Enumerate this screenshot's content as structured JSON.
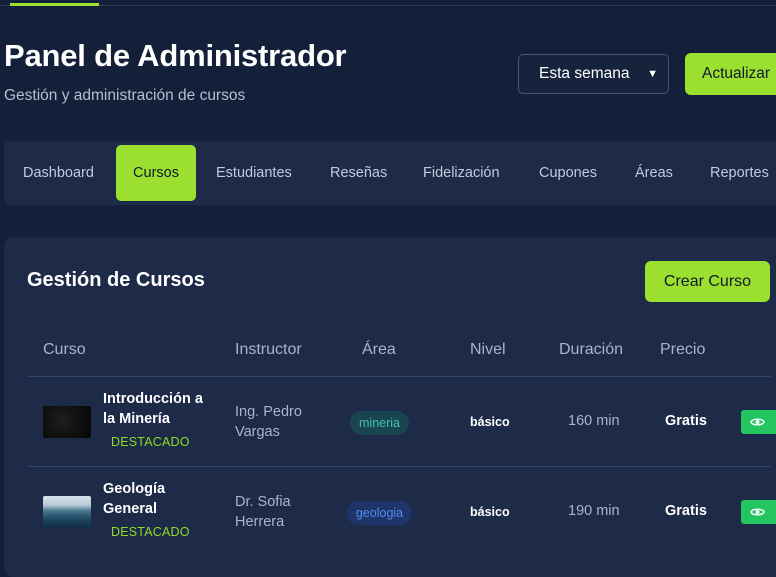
{
  "header": {
    "title": "Panel de Administrador",
    "subtitle": "Gestión y administración de cursos",
    "period_select": {
      "value": "Esta semana"
    },
    "update_label": "Actualizar"
  },
  "tabs": [
    {
      "label": "Dashboard",
      "active": false
    },
    {
      "label": "Cursos",
      "active": true
    },
    {
      "label": "Estudiantes",
      "active": false
    },
    {
      "label": "Reseñas",
      "active": false
    },
    {
      "label": "Fidelización",
      "active": false
    },
    {
      "label": "Cupones",
      "active": false
    },
    {
      "label": "Áreas",
      "active": false
    },
    {
      "label": "Reportes",
      "active": false
    }
  ],
  "courses_panel": {
    "title": "Gestión de Cursos",
    "create_label": "Crear Curso",
    "columns": [
      "Curso",
      "Instructor",
      "Área",
      "Nivel",
      "Duración",
      "Precio"
    ],
    "rows": [
      {
        "name": "Introducción a la Minería",
        "featured": "DESTACADO",
        "instructor": "Ing. Pedro Vargas",
        "area": "mineria",
        "level": "básico",
        "duration": "160 min",
        "price": "Gratis",
        "thumb_icon": "dark-mine-image"
      },
      {
        "name": "Geología General",
        "featured": "DESTACADO",
        "instructor": "Dr. Sofia Herrera",
        "area": "geologia",
        "level": "básico",
        "duration": "190 min",
        "price": "Gratis",
        "thumb_icon": "ocean-wave-image"
      }
    ]
  },
  "colors": {
    "background": "#14203a",
    "panel": "#1d2a48",
    "accent": "#9be02f",
    "featured_text": "#8edc26",
    "view_button": "#22c55e"
  }
}
